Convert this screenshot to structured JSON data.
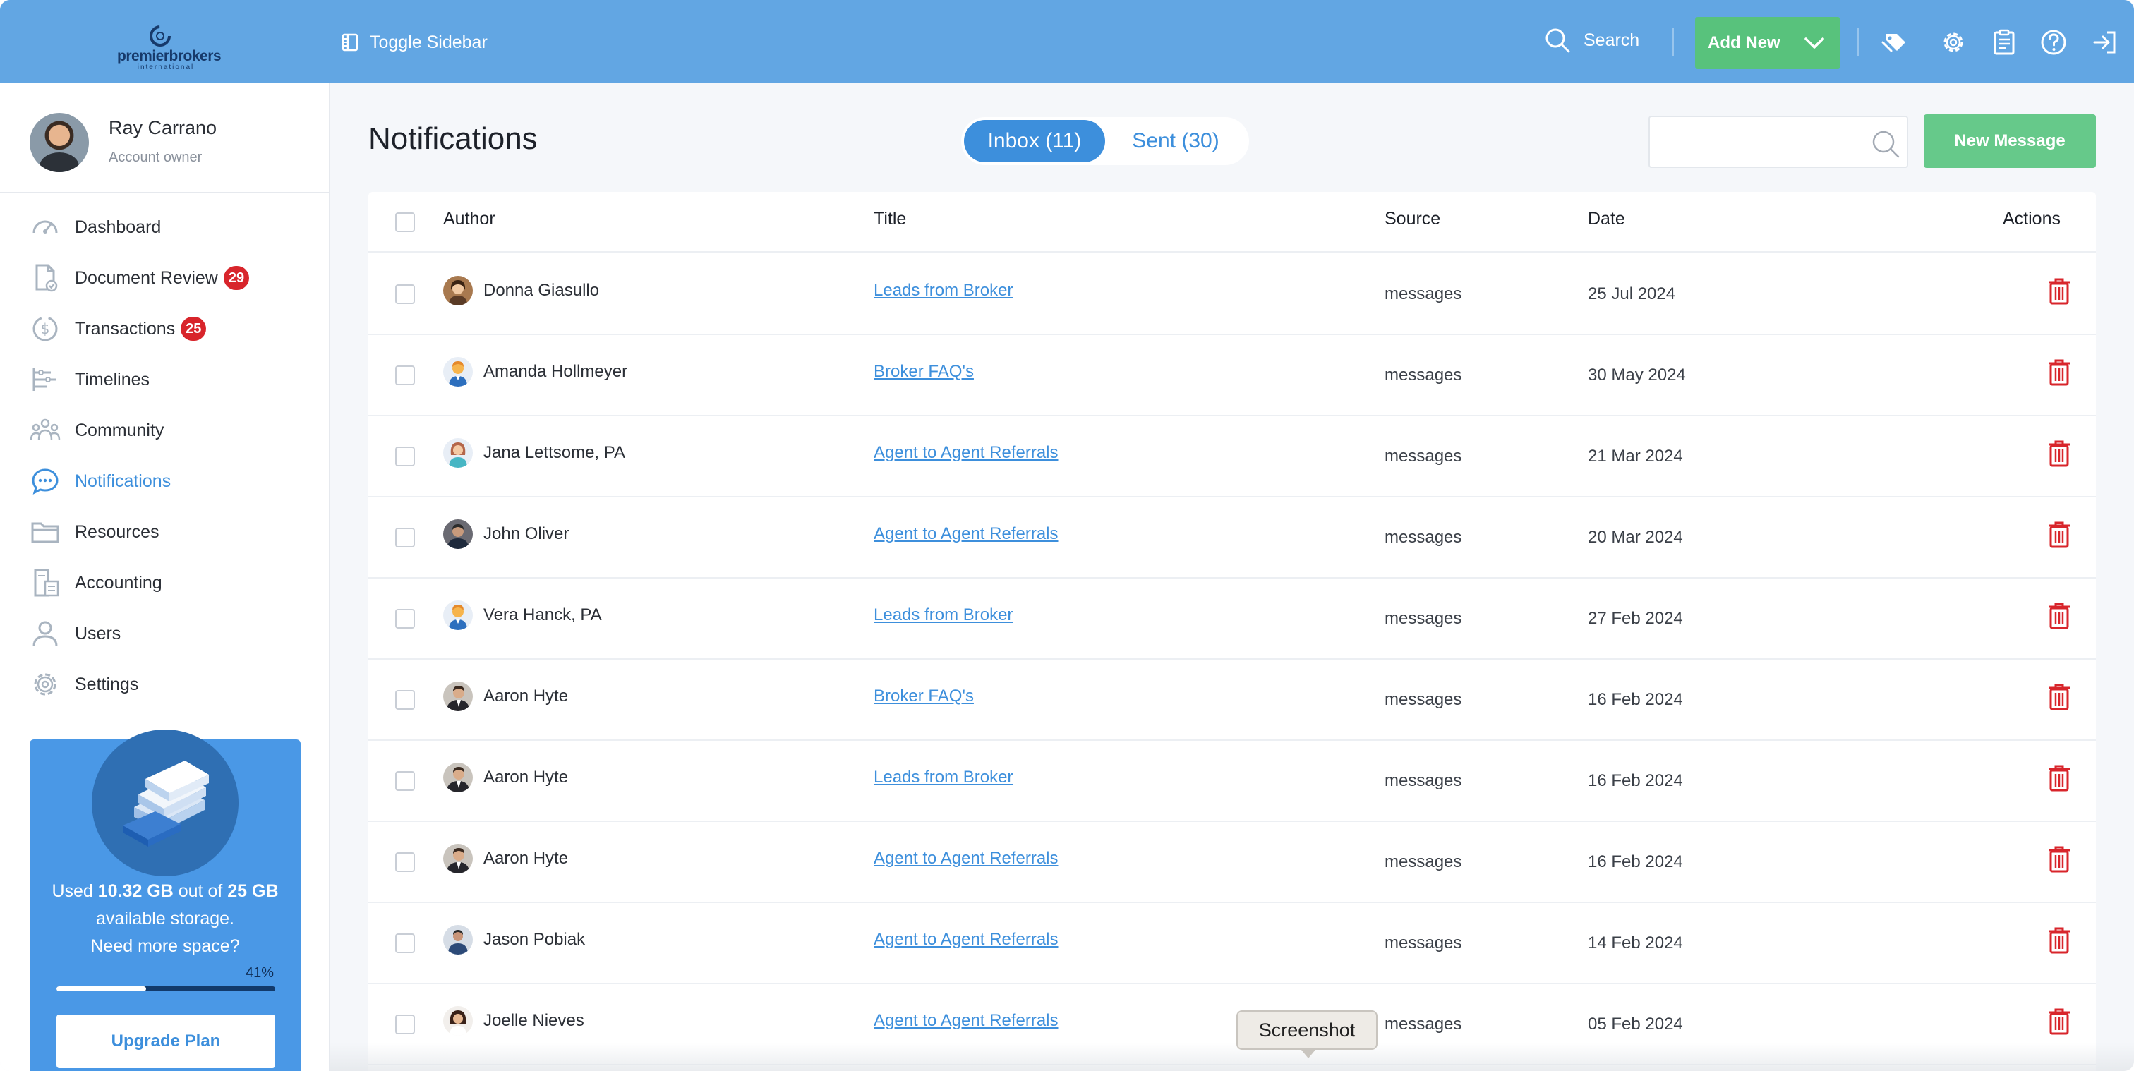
{
  "header": {
    "logo_name": "premierbrokers",
    "logo_sub": "international",
    "toggle_sidebar": "Toggle Sidebar",
    "search_label": "Search",
    "add_new": "Add New"
  },
  "profile": {
    "name": "Ray Carrano",
    "role": "Account owner"
  },
  "sidebar": {
    "items": [
      {
        "label": "Dashboard",
        "icon": "dashboard-icon",
        "badge": ""
      },
      {
        "label": "Document Review",
        "icon": "document-check-icon",
        "badge": "29"
      },
      {
        "label": "Transactions",
        "icon": "dollar-cycle-icon",
        "badge": "25"
      },
      {
        "label": "Timelines",
        "icon": "timeline-icon",
        "badge": ""
      },
      {
        "label": "Community",
        "icon": "community-icon",
        "badge": ""
      },
      {
        "label": "Notifications",
        "icon": "chat-bubble-icon",
        "badge": ""
      },
      {
        "label": "Resources",
        "icon": "folder-icon",
        "badge": ""
      },
      {
        "label": "Accounting",
        "icon": "calculator-icon",
        "badge": ""
      },
      {
        "label": "Users",
        "icon": "user-icon",
        "badge": ""
      },
      {
        "label": "Settings",
        "icon": "gear-icon",
        "badge": ""
      }
    ],
    "active_index": 5
  },
  "storage": {
    "used_prefix": "Used ",
    "used": "10.32 GB",
    "middle": " out of ",
    "total": "25 GB",
    "suffix": " available storage.",
    "line2": "Need more space?",
    "percent_label": "41%",
    "percent_value": 41,
    "upgrade": "Upgrade Plan"
  },
  "main": {
    "title": "Notifications",
    "tabs": [
      {
        "label": "Inbox (11)",
        "active": true
      },
      {
        "label": "Sent (30)",
        "active": false
      }
    ],
    "search_placeholder": "",
    "new_message": "New Message"
  },
  "table": {
    "columns": [
      "Author",
      "Title",
      "Source",
      "Date",
      "Actions"
    ],
    "rows": [
      {
        "author": "Donna Giasullo",
        "title": "Leads from Broker",
        "source": "messages",
        "date": "25 Jul 2024",
        "avatar": "photo-woman"
      },
      {
        "author": "Amanda Hollmeyer",
        "title": "Broker FAQ's",
        "source": "messages",
        "date": "30 May 2024",
        "avatar": "placeholder-man"
      },
      {
        "author": "Jana Lettsome, PA",
        "title": "Agent to Agent Referrals",
        "source": "messages",
        "date": "21 Mar 2024",
        "avatar": "placeholder-woman"
      },
      {
        "author": "John Oliver",
        "title": "Agent to Agent Referrals",
        "source": "messages",
        "date": "20 Mar 2024",
        "avatar": "photo-man-dark"
      },
      {
        "author": "Vera Hanck, PA",
        "title": "Leads from Broker",
        "source": "messages",
        "date": "27 Feb 2024",
        "avatar": "placeholder-man"
      },
      {
        "author": "Aaron Hyte",
        "title": "Broker FAQ's",
        "source": "messages",
        "date": "16 Feb 2024",
        "avatar": "photo-man-suit"
      },
      {
        "author": "Aaron Hyte",
        "title": "Leads from Broker",
        "source": "messages",
        "date": "16 Feb 2024",
        "avatar": "photo-man-suit"
      },
      {
        "author": "Aaron Hyte",
        "title": "Agent to Agent Referrals",
        "source": "messages",
        "date": "16 Feb 2024",
        "avatar": "photo-man-suit"
      },
      {
        "author": "Jason Pobiak",
        "title": "Agent to Agent Referrals",
        "source": "messages",
        "date": "14 Feb 2024",
        "avatar": "photo-man-blue"
      },
      {
        "author": "Joelle Nieves",
        "title": "Agent to Agent Referrals",
        "source": "messages",
        "date": "05 Feb 2024",
        "avatar": "photo-woman-light"
      }
    ]
  },
  "tooltip": "Screenshot",
  "colors": {
    "topbar": "#62a6e3",
    "accent": "#3d8fdc",
    "green": "#58c27c",
    "danger": "#d8252b"
  }
}
